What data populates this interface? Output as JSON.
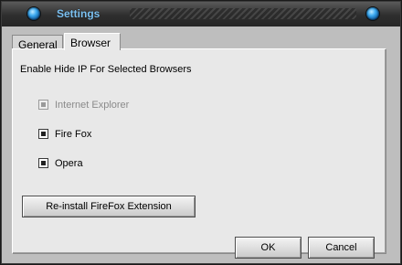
{
  "window": {
    "title": "Settings"
  },
  "tabs": [
    {
      "label": "General",
      "active": false
    },
    {
      "label": "Browser",
      "active": true
    }
  ],
  "browser_tab": {
    "heading": "Enable Hide IP For Selected Browsers",
    "browsers": [
      {
        "label": "Internet Explorer",
        "checked": true,
        "disabled": true
      },
      {
        "label": "Fire Fox",
        "checked": true,
        "disabled": false
      },
      {
        "label": "Opera",
        "checked": true,
        "disabled": false
      }
    ],
    "reinstall_label": "Re-install FireFox Extension"
  },
  "buttons": {
    "ok": "OK",
    "cancel": "Cancel"
  },
  "colors": {
    "title_text": "#7cc2f2",
    "window_frame": "#3c3c3c",
    "panel_bg": "#e8e8e8"
  },
  "icons": {
    "title_left": "blue-orb-icon",
    "title_right": "blue-orb-icon"
  }
}
